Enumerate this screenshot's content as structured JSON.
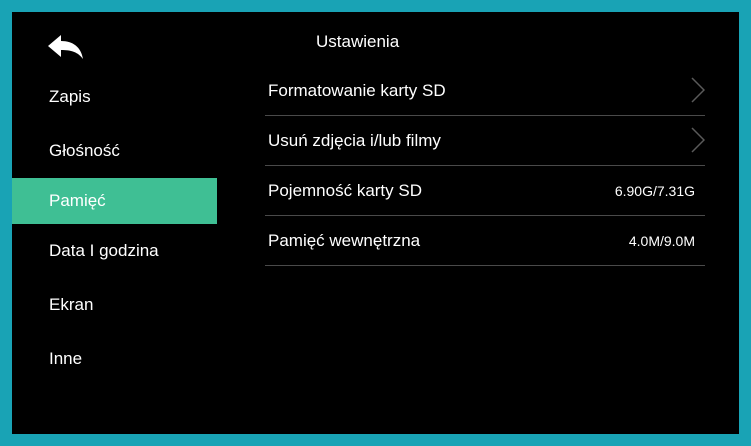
{
  "header": {
    "title": "Ustawienia",
    "back_icon": "back-arrow-icon"
  },
  "sidebar": {
    "items": [
      {
        "label": "Zapis"
      },
      {
        "label": "Głośność"
      },
      {
        "label": "Pamięć",
        "active": true
      },
      {
        "label": "Data I godzina"
      },
      {
        "label": "Ekran"
      },
      {
        "label": "Inne"
      }
    ]
  },
  "main": {
    "rows": [
      {
        "label": "Formatowanie karty SD",
        "icon": "chevron-right-icon"
      },
      {
        "label": "Usuń zdjęcia i/lub filmy",
        "icon": "chevron-right-icon"
      },
      {
        "label": "Pojemność karty SD",
        "value": "6.90G/7.31G"
      },
      {
        "label": "Pamięć wewnętrzna",
        "value": "4.0M/9.0M"
      }
    ]
  },
  "colors": {
    "frame": "#19a3b5",
    "background": "#000000",
    "active": "#3fbf94",
    "text": "#ffffff",
    "divider": "#4a4a4a",
    "chevron": "#5a5a5a"
  }
}
